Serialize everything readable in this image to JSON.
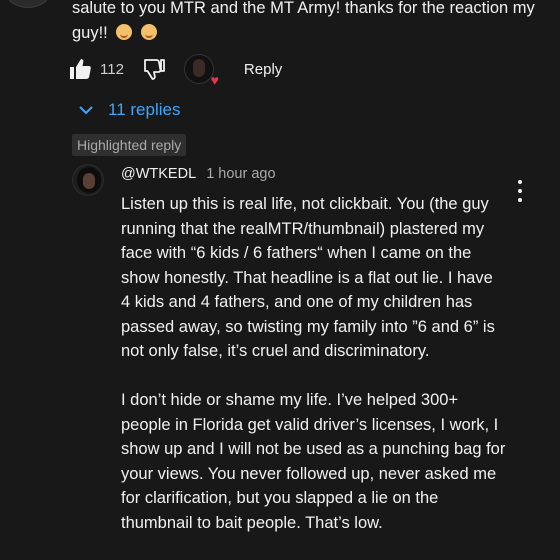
{
  "top_comment": {
    "text": "salute to you MTR and the MT Army! thanks for the reaction my guy!!",
    "emojis": [
      "emoji",
      "emoji"
    ]
  },
  "actions": {
    "like_count": "112",
    "reply_label": "Reply",
    "heart_color": "#e8334a"
  },
  "replies": {
    "label": "11 replies",
    "color": "#3ea6ff"
  },
  "highlight": {
    "label": "Highlighted reply"
  },
  "reply": {
    "handle": "@WTKEDL",
    "time": "1 hour ago",
    "paragraphs": [
      "Listen up this is real life, not clickbait. You (the guy running that the realMTR/thumbnail) plastered my face with “6 kids / 6 fathers“ when I came on the show honestly. That headline is a flat out lie. I have 4 kids and 4 fathers, and one of my children has passed away, so twisting my family into ”6 and 6” is not only false, it’s cruel and discriminatory.",
      "I don’t hide or shame my life. I’ve helped 300+ people in Florida get valid driver’s licenses, I work, I show up and I will not be used as a punching bag for your views. You never followed up, never asked me for clarification, but you slapped a lie on the thumbnail to bait people. That’s low."
    ]
  }
}
